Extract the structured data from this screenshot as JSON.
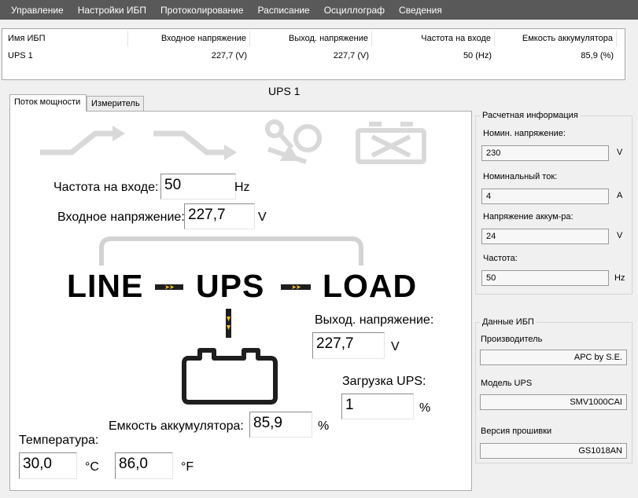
{
  "menu": [
    "Управление",
    "Настройки ИБП",
    "Протоколирование",
    "Расписание",
    "Осциллограф",
    "Сведения"
  ],
  "ups_list": {
    "headers": [
      "Имя ИБП",
      "Входное напряжение",
      "Выход. напряжение",
      "Частота на входе",
      "Емкость аккумулятора"
    ],
    "rows": [
      [
        "UPS 1",
        "227,7 (V)",
        "227,7 (V)",
        "50 (Hz)",
        "85,9 (%)"
      ]
    ]
  },
  "ups_title": "UPS 1",
  "tabs": [
    "Поток мощности",
    "Измеритель"
  ],
  "flow": {
    "input_freq": {
      "label": "Частота на входе:",
      "value": "50",
      "unit": "Hz"
    },
    "input_voltage": {
      "label": "Входное напряжение:",
      "value": "227,7",
      "unit": "V"
    },
    "output_voltage": {
      "label": "Выход. напряжение:",
      "value": "227,7",
      "unit": "V"
    },
    "ups_load": {
      "label": "Загрузка UPS:",
      "value": "1",
      "unit": "%"
    },
    "battery_capacity": {
      "label": "Емкость аккумулятора:",
      "value": "85,9",
      "unit": "%"
    },
    "temperature": {
      "label": "Температура:",
      "celsius": "30,0",
      "celsius_unit": "°C",
      "fahrenheit": "86,0",
      "fahrenheit_unit": "°F"
    },
    "line_label": "LINE",
    "ups_label": "UPS",
    "load_label": "LOAD",
    "connector_arrows": "➤➤"
  },
  "calc_info": {
    "title": "Расчетная информация",
    "nominal_voltage": {
      "label": "Номин. напряжение:",
      "value": "230",
      "unit": "V"
    },
    "nominal_current": {
      "label": "Номинальный ток:",
      "value": "4",
      "unit": "A"
    },
    "battery_voltage": {
      "label": "Напряжение аккум-ра:",
      "value": "24",
      "unit": "V"
    },
    "frequency": {
      "label": "Частота:",
      "value": "50",
      "unit": "Hz"
    }
  },
  "ups_data": {
    "title": "Данные ИБП",
    "manufacturer": {
      "label": "Производитель",
      "value": "APC by S.E."
    },
    "model": {
      "label": "Модель UPS",
      "value": "SMV1000CAI"
    },
    "firmware": {
      "label": "Версия прошивки",
      "value": "GS1018AN"
    }
  },
  "colors": {
    "menubar": "#595959",
    "connector": "#1e1e1e",
    "arrow": "#f7c31b",
    "inactive_icon": "#d9d9d9"
  }
}
